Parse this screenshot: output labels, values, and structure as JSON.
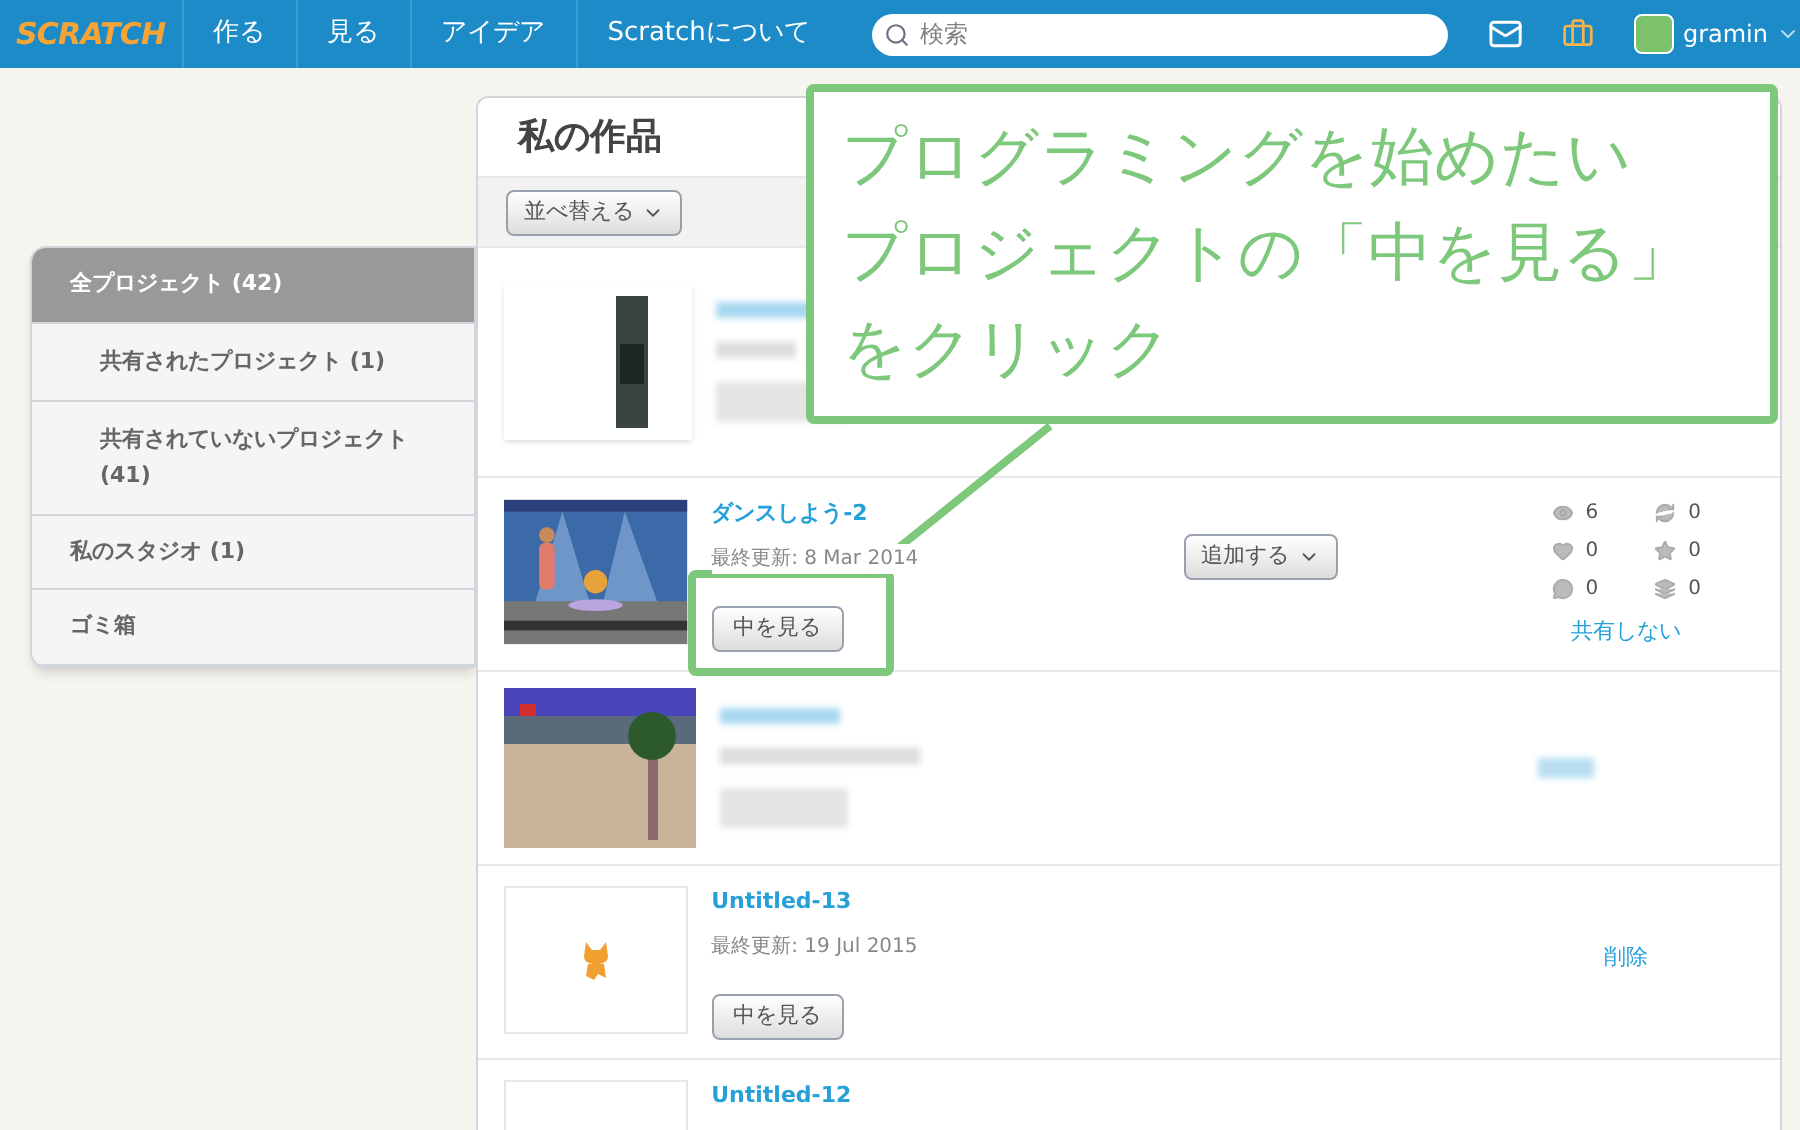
{
  "nav": {
    "logo": "SCRATCH",
    "items": [
      "作る",
      "見る",
      "アイデア",
      "Scratchについて"
    ],
    "search": {
      "placeholder": "検索"
    },
    "user": "gramin"
  },
  "sidebar": {
    "items": [
      {
        "label": "全プロジェクト (42)",
        "selected": true,
        "children": [
          {
            "label": "共有されたプロジェクト (1)",
            "selected": false
          },
          {
            "label": "共有されていないプロジェクト (41)",
            "selected": false
          }
        ]
      },
      {
        "label": "私のスタジオ (1)",
        "selected": false
      },
      {
        "label": "ゴミ箱",
        "selected": false
      }
    ]
  },
  "main": {
    "title": "私の作品",
    "sort_button": "並べ替える",
    "projects": [
      {
        "kind": "blurred"
      },
      {
        "kind": "project",
        "title": "ダンスしよう-2",
        "updated": "最終更新: 8 Mar 2014",
        "button": "中を見る",
        "add_button": "追加する",
        "stats": [
          {
            "kind": "views",
            "value": "6"
          },
          {
            "kind": "remixes",
            "value": "0"
          },
          {
            "kind": "loves",
            "value": "0"
          },
          {
            "kind": "favorites",
            "value": "0"
          },
          {
            "kind": "comments",
            "value": "0"
          },
          {
            "kind": "studios",
            "value": "0"
          }
        ],
        "action": "共有しない"
      },
      {
        "kind": "blurred"
      },
      {
        "kind": "project",
        "title": "Untitled-13",
        "updated": "最終更新: 19 Jul 2015",
        "button": "中を見る",
        "action": "削除"
      },
      {
        "kind": "project",
        "title": "Untitled-12"
      }
    ]
  },
  "callout": {
    "lines": [
      "プログラミングを始めたい",
      "プロジェクトの「中を見る」",
      "をクリック"
    ]
  }
}
